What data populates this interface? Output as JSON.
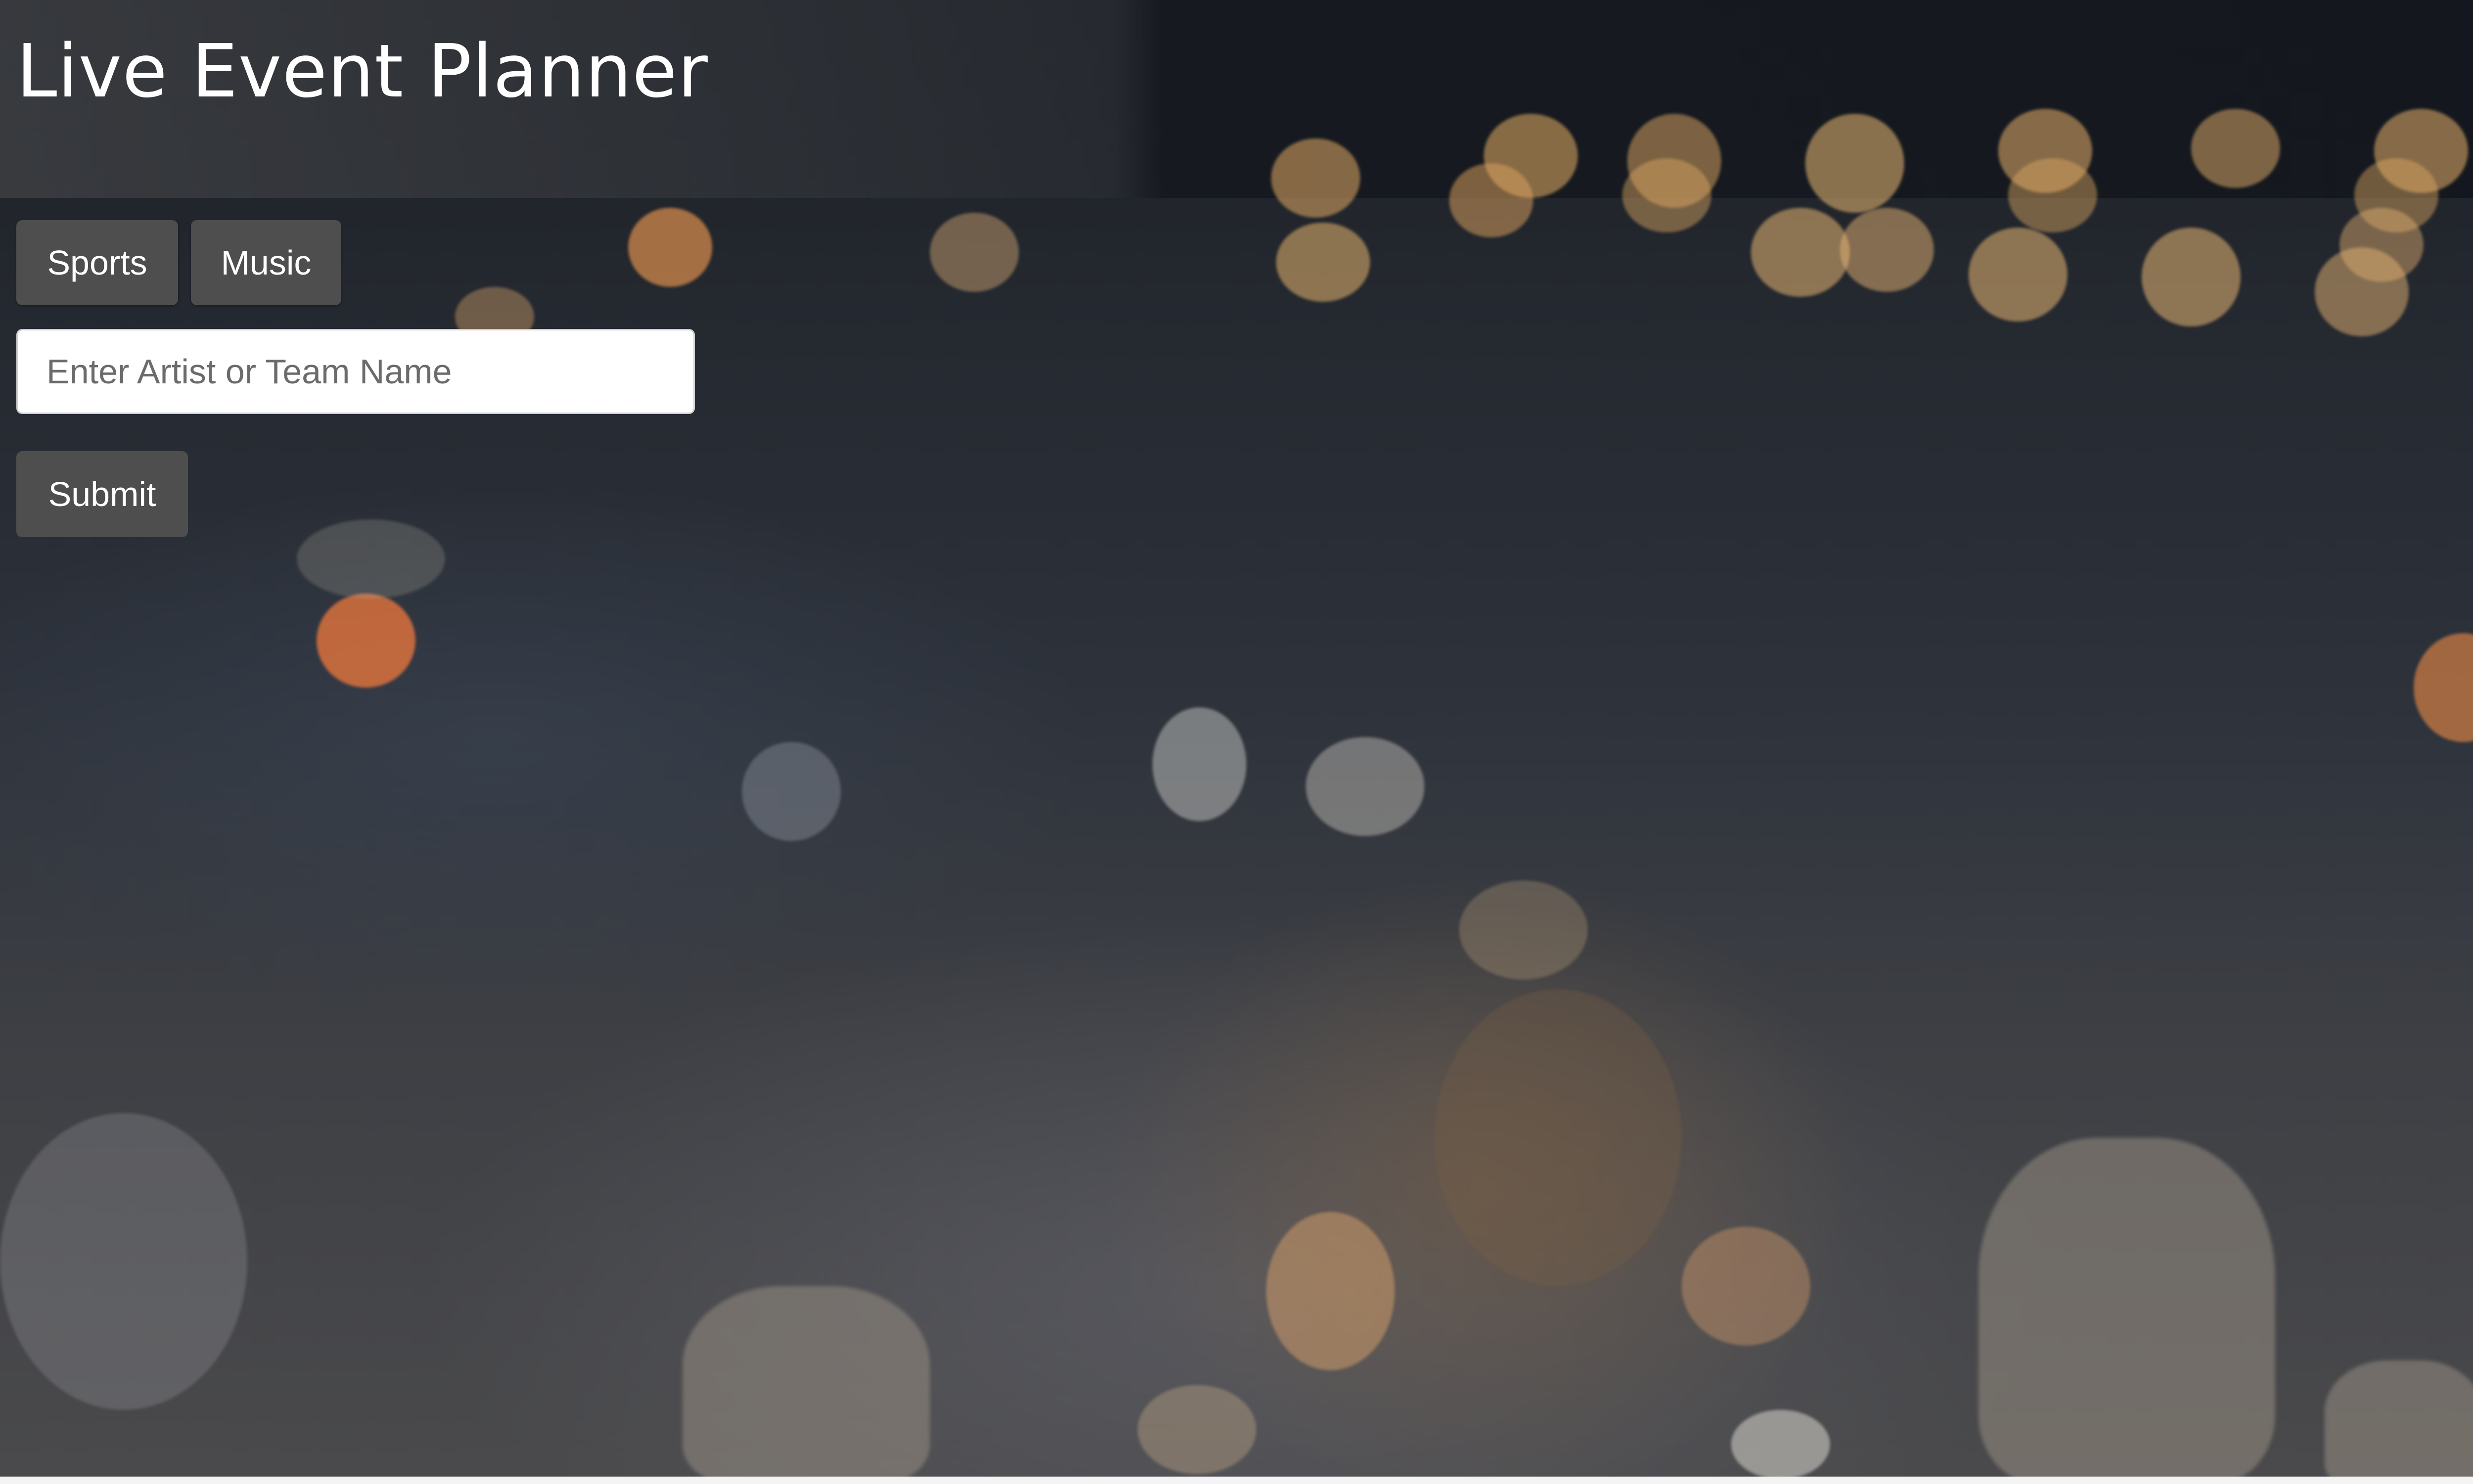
{
  "header": {
    "title": "Live Event Planner"
  },
  "categories": [
    {
      "label": "Sports"
    },
    {
      "label": "Music"
    }
  ],
  "search": {
    "placeholder": "Enter Artist or Team Name",
    "value": ""
  },
  "form": {
    "submit_label": "Submit"
  },
  "background": {
    "icon": "concert-crowd-photo"
  }
}
